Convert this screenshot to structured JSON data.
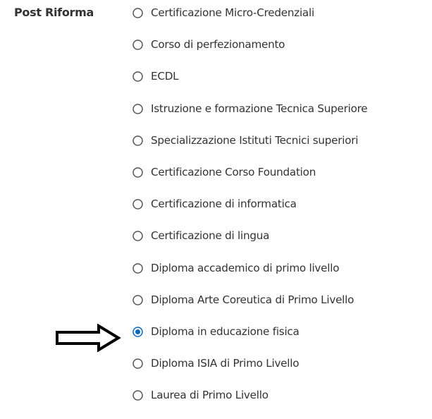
{
  "section": {
    "label": "Post Riforma"
  },
  "options": [
    {
      "label": "Certificazione Micro-Credenziali",
      "selected": false
    },
    {
      "label": "Corso di perfezionamento",
      "selected": false
    },
    {
      "label": "ECDL",
      "selected": false
    },
    {
      "label": "Istruzione e formazione Tecnica Superiore",
      "selected": false
    },
    {
      "label": "Specializzazione Istituti Tecnici superiori",
      "selected": false
    },
    {
      "label": "Certificazione Corso Foundation",
      "selected": false
    },
    {
      "label": "Certificazione di informatica",
      "selected": false
    },
    {
      "label": "Certificazione di lingua",
      "selected": false
    },
    {
      "label": "Diploma accademico di primo livello",
      "selected": false
    },
    {
      "label": "Diploma Arte Coreutica di Primo Livello",
      "selected": false
    },
    {
      "label": "Diploma in educazione fisica",
      "selected": true
    },
    {
      "label": "Diploma ISIA di Primo Livello",
      "selected": false
    },
    {
      "label": "Laurea di Primo Livello",
      "selected": false
    }
  ],
  "annotation": {
    "icon": "right-arrow-icon",
    "points_to_option": 10
  },
  "colors": {
    "text": "#333333",
    "radio_border": "#555555",
    "radio_selected": "#0b67c2",
    "arrow": "#000000"
  }
}
